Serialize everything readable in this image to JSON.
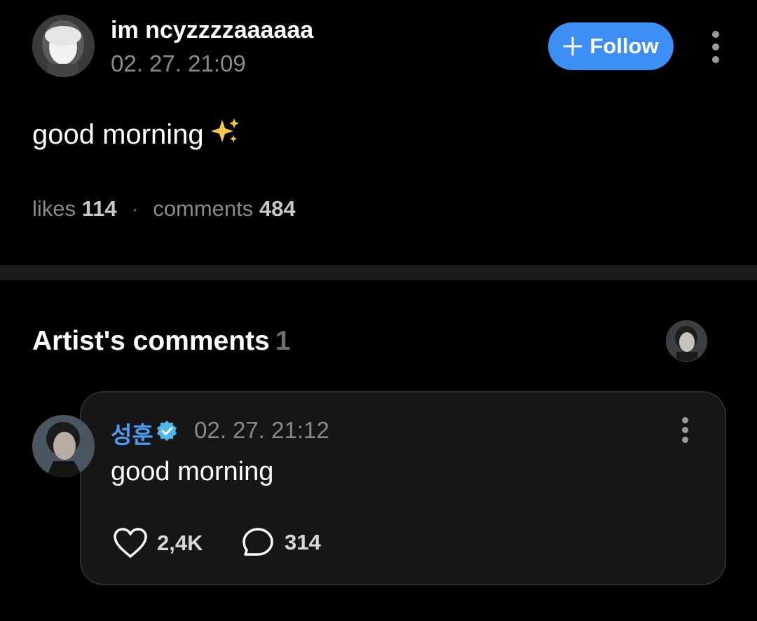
{
  "post": {
    "author_name": "im ncyzzzzaaaaaa",
    "timestamp": "02. 27. 21:09",
    "text": "good morning",
    "emoji": "✨",
    "stats": {
      "likes_label": "likes",
      "likes_count": "114",
      "separator": "·",
      "comments_label": "comments",
      "comments_count": "484"
    }
  },
  "follow_button": {
    "label": "Follow",
    "color": "#3d8ff5"
  },
  "artist_comments": {
    "title": "Artist's comments",
    "count": "1"
  },
  "comment": {
    "author_name": "성훈",
    "author_color": "#4a9cf6",
    "verified_icon": "verified-badge-icon",
    "timestamp": "02. 27. 21:12",
    "text": "good morning",
    "likes": "2,4K",
    "replies": "314"
  },
  "icons": {
    "more": "more-vertical-icon",
    "like": "heart-outline-icon",
    "reply": "chat-bubble-outline-icon",
    "plus": "plus-icon"
  }
}
